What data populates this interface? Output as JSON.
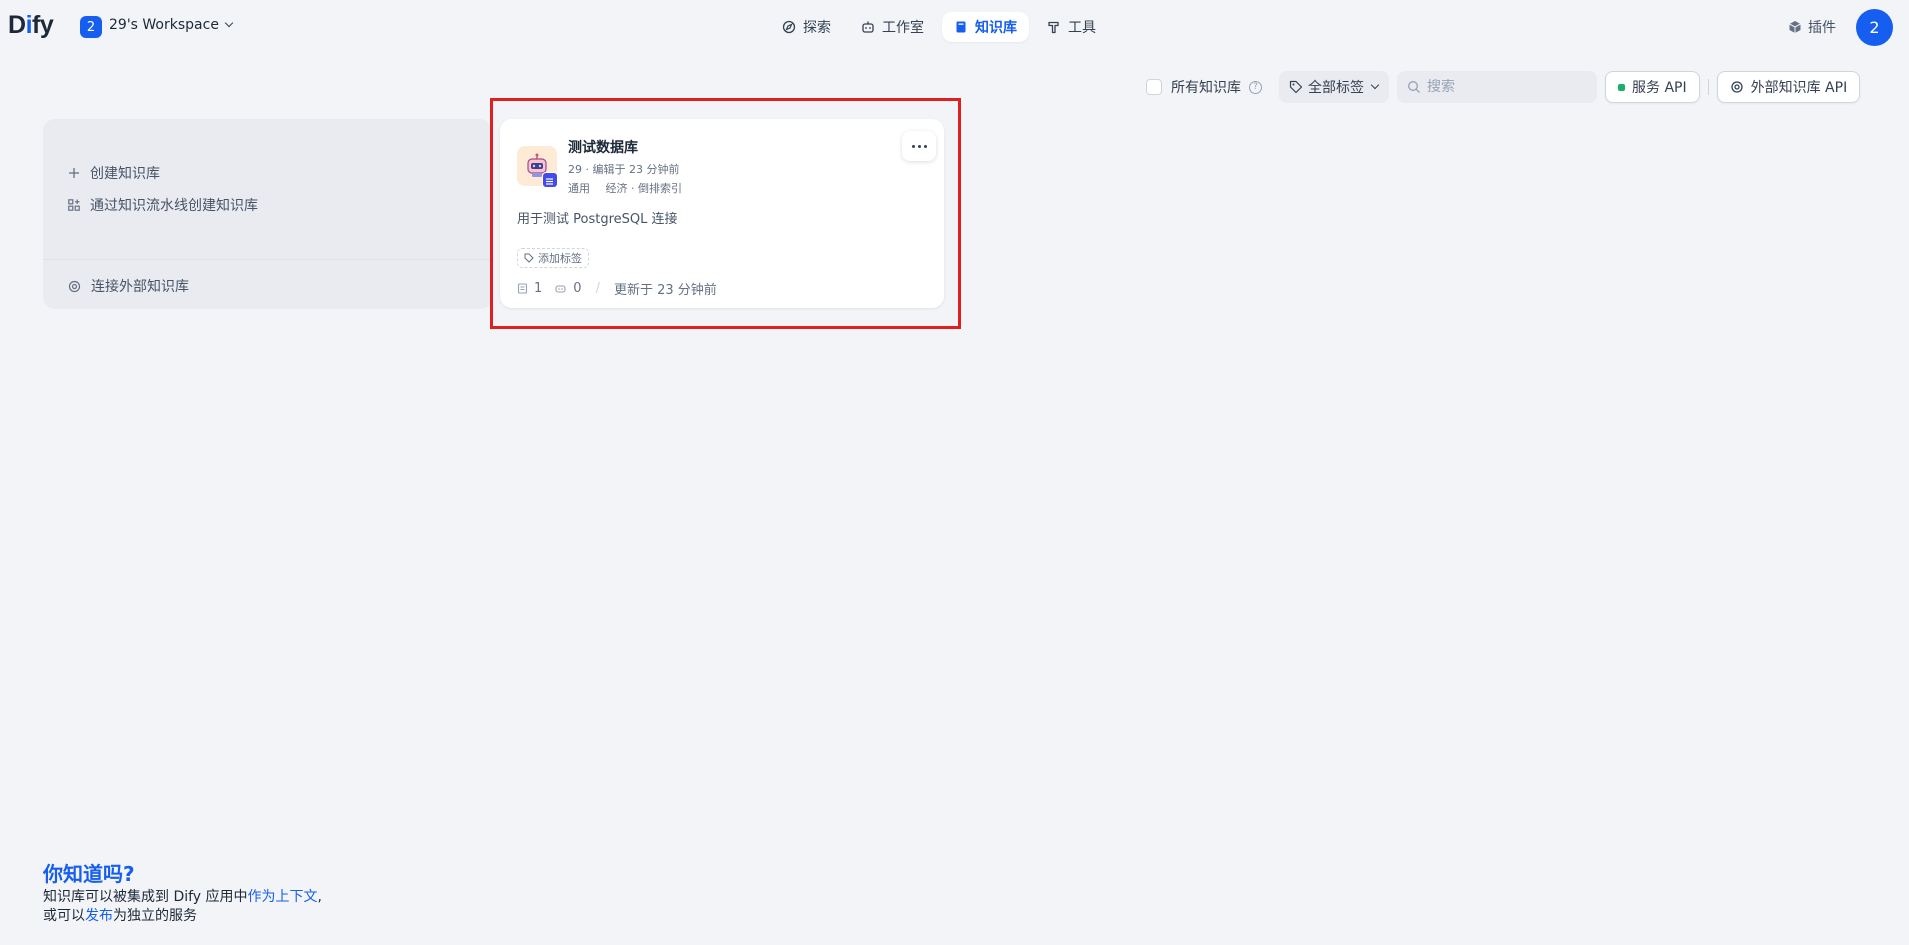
{
  "header": {
    "logo": "Dify",
    "workspace_badge": "2",
    "workspace_name": "29's Workspace",
    "nav": [
      {
        "label": "探索",
        "icon": "compass-icon",
        "active": false
      },
      {
        "label": "工作室",
        "icon": "robot-icon",
        "active": false
      },
      {
        "label": "知识库",
        "icon": "book-icon",
        "active": true
      },
      {
        "label": "工具",
        "icon": "hammer-icon",
        "active": false
      }
    ],
    "plugin_label": "插件",
    "avatar_initial": "2",
    "accent_color": "#155eef"
  },
  "toolbar": {
    "all_datasets_label": "所有知识库",
    "tag_filter_label": "全部标签",
    "search_placeholder": "搜索",
    "service_api_label": "服务 API",
    "external_api_label": "外部知识库 API"
  },
  "create_panel": {
    "create_label": "创建知识库",
    "pipeline_label": "通过知识流水线创建知识库",
    "connect_external_label": "连接外部知识库"
  },
  "datasets": [
    {
      "title": "测试数据库",
      "meta": "29 · 编辑于 23 分钟前",
      "mode": "通用",
      "index": "经济 · 倒排索引",
      "description": "用于测试 PostgreSQL 连接",
      "add_tag_label": "添加标签",
      "doc_count": "1",
      "app_count": "0",
      "separator": "/",
      "updated": "更新于 23 分钟前"
    }
  ],
  "tip": {
    "title": "你知道吗?",
    "line1_prefix": "知识库可以被集成到 Dify 应用中",
    "line1_link": "作为上下文",
    "line1_suffix": ",",
    "line2_prefix": "或可以",
    "line2_link": "发布",
    "line2_suffix": "为独立的服务"
  }
}
